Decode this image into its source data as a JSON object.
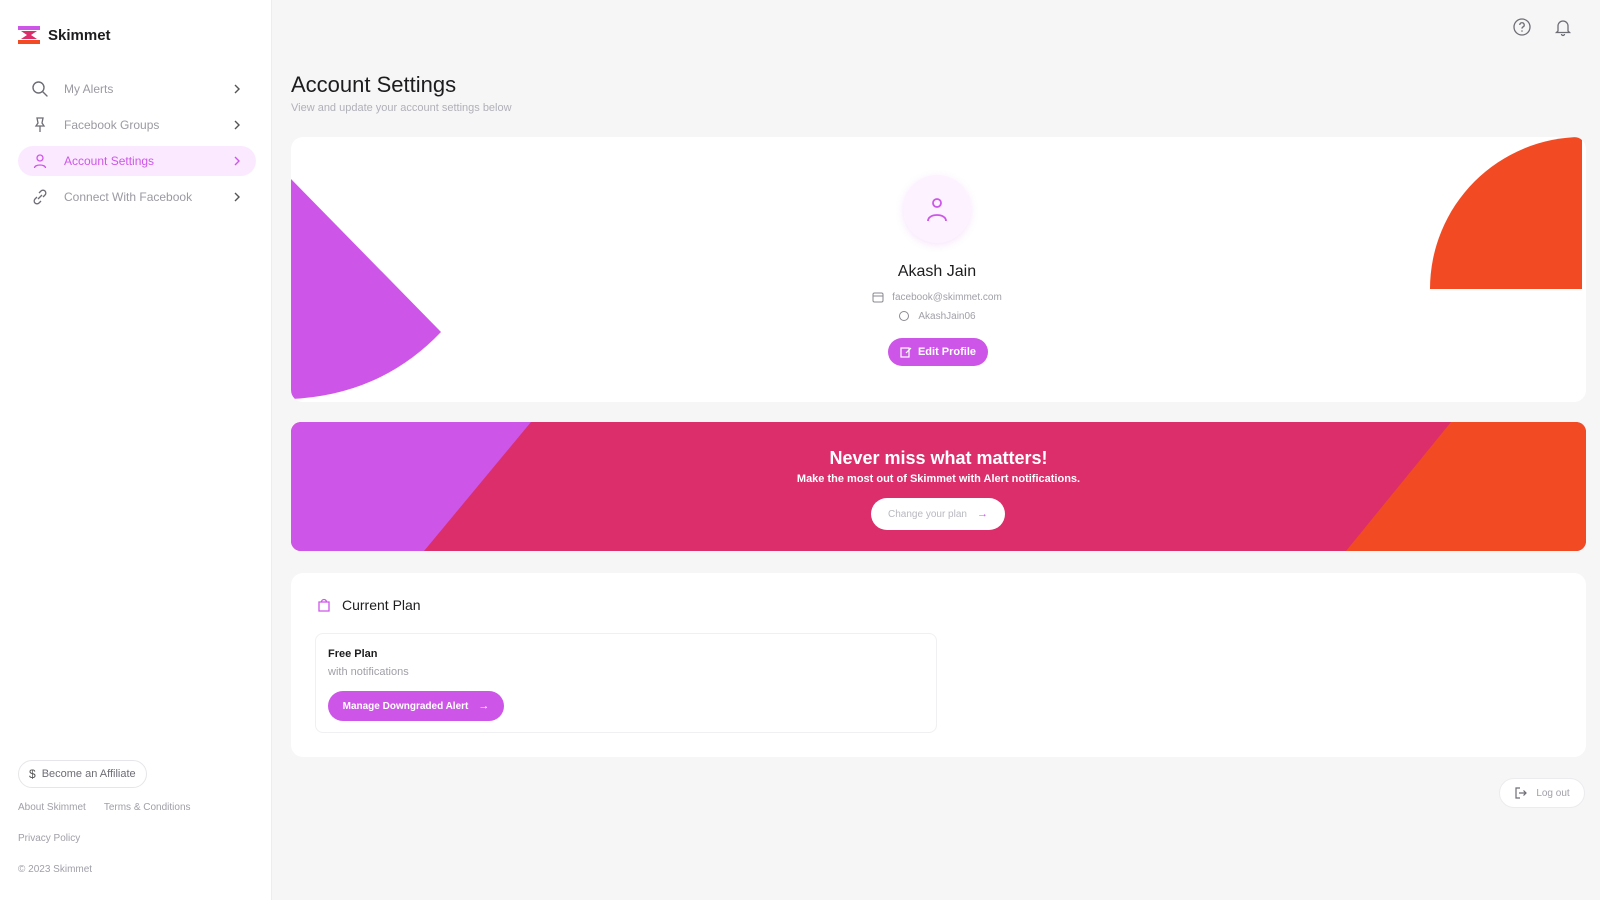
{
  "app": {
    "name": "Skimmet"
  },
  "sidebar": {
    "items": [
      {
        "label": "My Alerts",
        "icon": "search-icon",
        "active": false
      },
      {
        "label": "Facebook Groups",
        "icon": "pin-icon",
        "active": false
      },
      {
        "label": "Account Settings",
        "icon": "user-icon",
        "active": true
      },
      {
        "label": "Connect With Facebook",
        "icon": "link-icon",
        "active": false
      }
    ],
    "affiliate_label": "Become an Affiliate",
    "footer": {
      "about": "About Skimmet",
      "terms": "Terms & Conditions",
      "privacy": "Privacy Policy",
      "copyright": "© 2023 Skimmet"
    }
  },
  "header": {
    "help_icon": "help-icon",
    "notification_icon": "bell-icon"
  },
  "page": {
    "title": "Account Settings",
    "subtitle": "View and update your account settings below"
  },
  "profile": {
    "name": "Akash Jain",
    "email": "facebook@skimmet.com",
    "username": "AkashJain06",
    "edit_label": "Edit Profile"
  },
  "promo": {
    "title": "Never miss what matters!",
    "subtitle": "Make the most out of Skimmet with Alert notifications.",
    "button_label": "Change your plan"
  },
  "plan": {
    "header": "Current Plan",
    "name": "Free Plan",
    "description": "with notifications",
    "manage_label": "Manage Downgraded Alert"
  },
  "logout_label": "Log out",
  "colors": {
    "accent": "#cd56e8",
    "promo_pink": "#dc2e6b",
    "promo_orange": "#f24b23",
    "shape_purple": "#cd56e8",
    "shape_orange": "#f24b23"
  }
}
